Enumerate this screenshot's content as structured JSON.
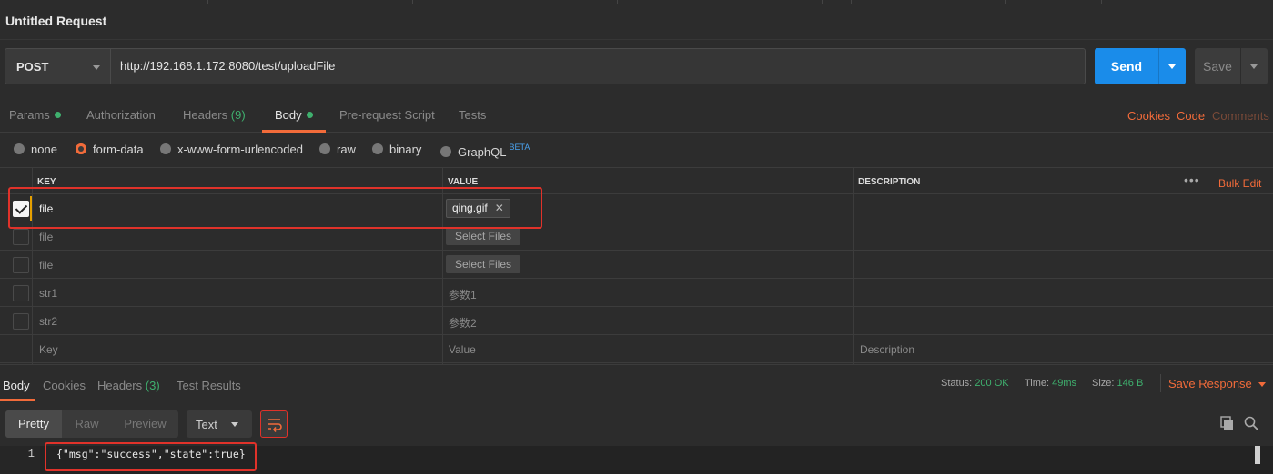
{
  "window": {
    "title": "Untitled Request"
  },
  "request": {
    "method": "POST",
    "url": "http://192.168.1.172:8080/test/uploadFile",
    "send_label": "Send",
    "save_label": "Save"
  },
  "tabs": {
    "params": "Params",
    "authorization": "Authorization",
    "headers": "Headers",
    "headers_count": "(9)",
    "body": "Body",
    "prerequest": "Pre-request Script",
    "tests": "Tests",
    "cookies": "Cookies",
    "code": "Code",
    "comments": "Comments"
  },
  "body_types": {
    "none": "none",
    "form_data": "form-data",
    "urlencoded": "x-www-form-urlencoded",
    "raw": "raw",
    "binary": "binary",
    "graphql": "GraphQL",
    "beta": "BETA",
    "selected": "form-data"
  },
  "table": {
    "headers": {
      "key": "KEY",
      "value": "VALUE",
      "description": "DESCRIPTION"
    },
    "bulk_edit": "Bulk Edit",
    "more": "•••",
    "rows": [
      {
        "checked": true,
        "key": "file",
        "value": "qing.gif",
        "remove": "✕"
      },
      {
        "checked": false,
        "key": "file",
        "value": "Select Files"
      },
      {
        "checked": false,
        "key": "file",
        "value": "Select Files"
      },
      {
        "checked": false,
        "key": "str1",
        "value": "参数1"
      },
      {
        "checked": false,
        "key": "str2",
        "value": "参数2"
      }
    ],
    "placeholder": {
      "key": "Key",
      "value": "Value",
      "description": "Description"
    }
  },
  "response": {
    "tabs": {
      "body": "Body",
      "cookies": "Cookies",
      "headers": "Headers",
      "headers_count": "(3)",
      "test_results": "Test Results"
    },
    "status_label": "Status:",
    "status_value": "200 OK",
    "time_label": "Time:",
    "time_value": "49ms",
    "size_label": "Size:",
    "size_value": "146 B",
    "save_response": "Save Response",
    "views": {
      "pretty": "Pretty",
      "raw": "Raw",
      "preview": "Preview"
    },
    "format": "Text",
    "line_number": "1",
    "body_text": "{\"msg\":\"success\",\"state\":true}"
  },
  "colors": {
    "accent": "#f26b3a",
    "send": "#1a8cea",
    "success": "#3fb06e",
    "highlight": "#e0322a"
  },
  "icons": [
    "chevron-down-icon",
    "check-icon",
    "close-icon",
    "wrap-icon",
    "copy-icon",
    "search-icon",
    "more-icon"
  ]
}
